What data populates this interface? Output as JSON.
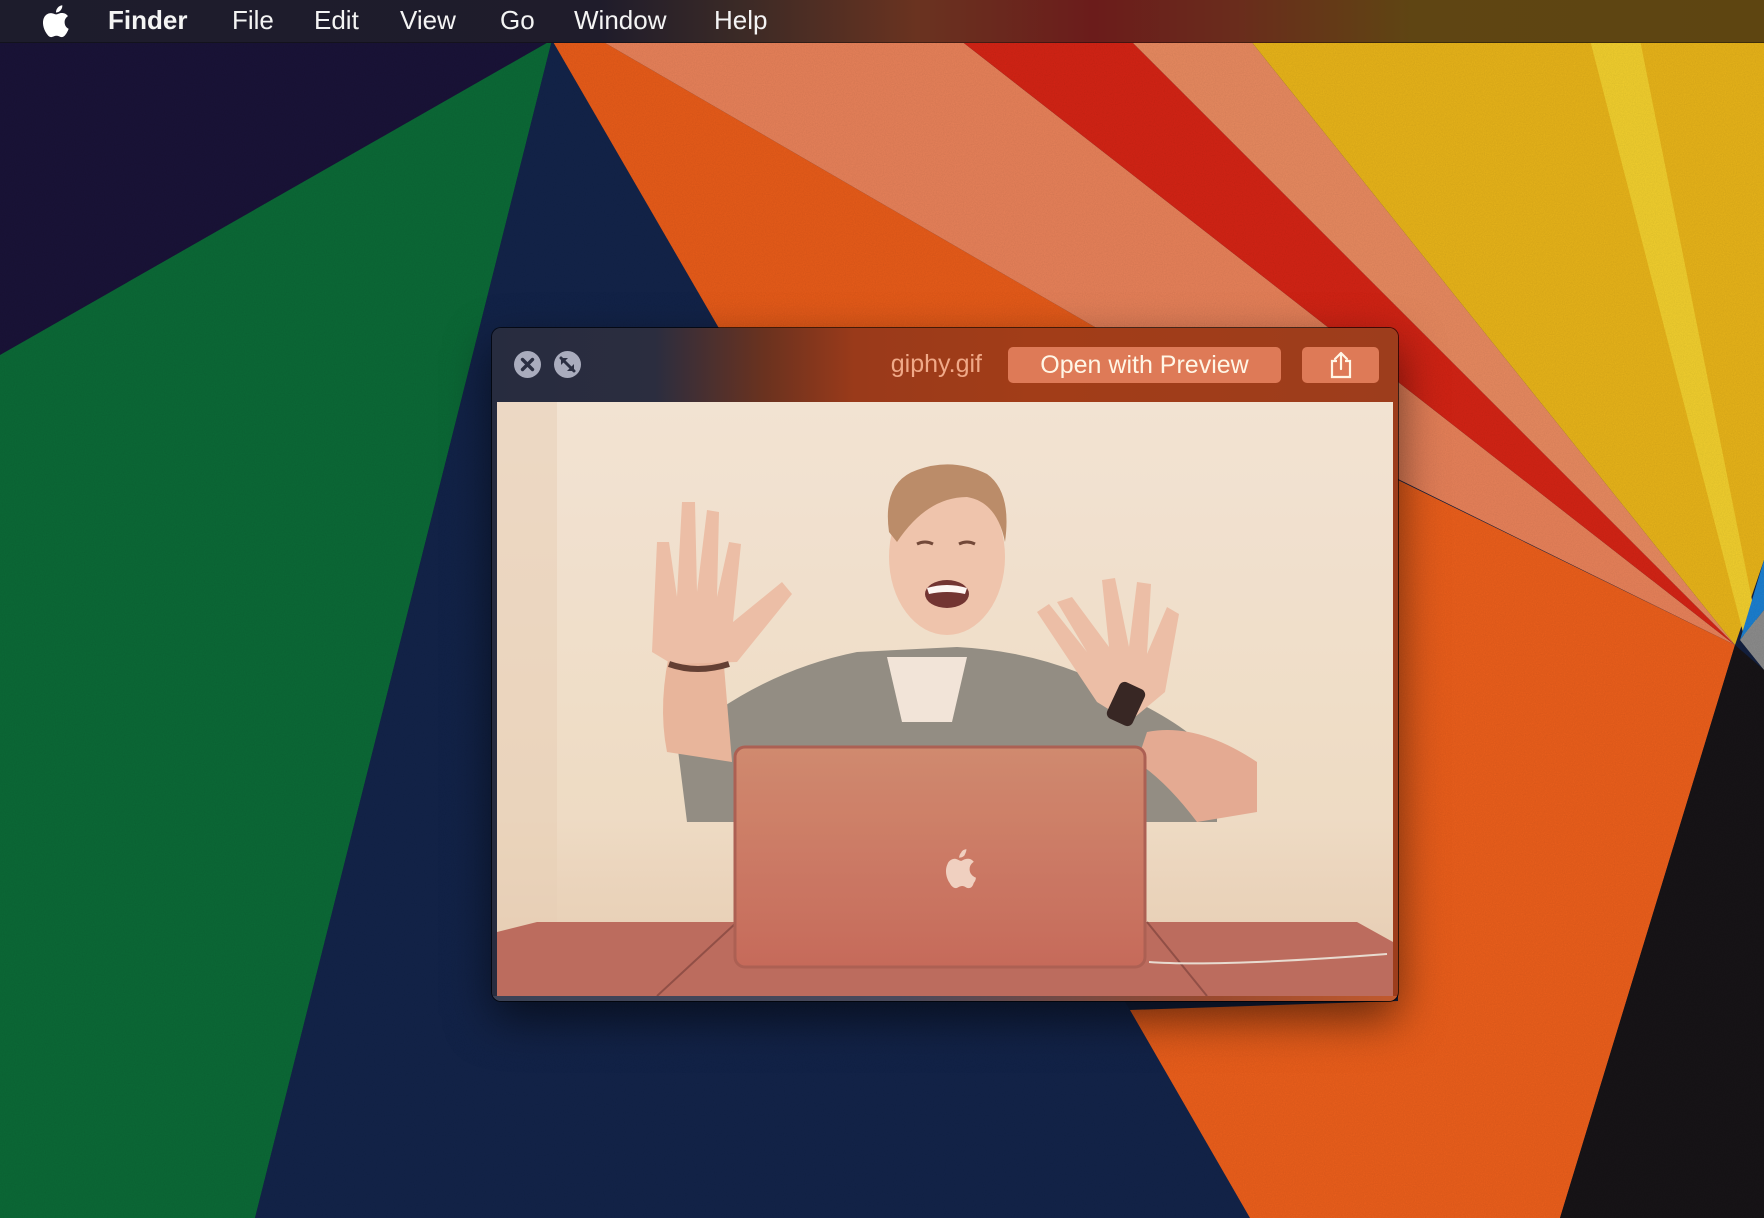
{
  "menubar": {
    "apple_icon": "apple-logo-icon",
    "app_name": "Finder",
    "items": [
      "File",
      "Edit",
      "View",
      "Go",
      "Window",
      "Help"
    ]
  },
  "quicklook": {
    "filename": "giphy.gif",
    "open_button_label": "Open with Preview",
    "close_icon": "close-icon",
    "fullscreen_icon": "fullscreen-icon",
    "share_icon": "share-icon",
    "image_description": "Animated GIF: young man laughing and waving both hands behind a laptop on a table"
  },
  "colors": {
    "titlebar_dark": "#272c3f",
    "titlebar_orange": "#a23d18",
    "button_fill": "#de7a57",
    "button_text": "#fff6e6",
    "filename_text": "#f0a988",
    "traffic_button": "#a9acbd"
  }
}
